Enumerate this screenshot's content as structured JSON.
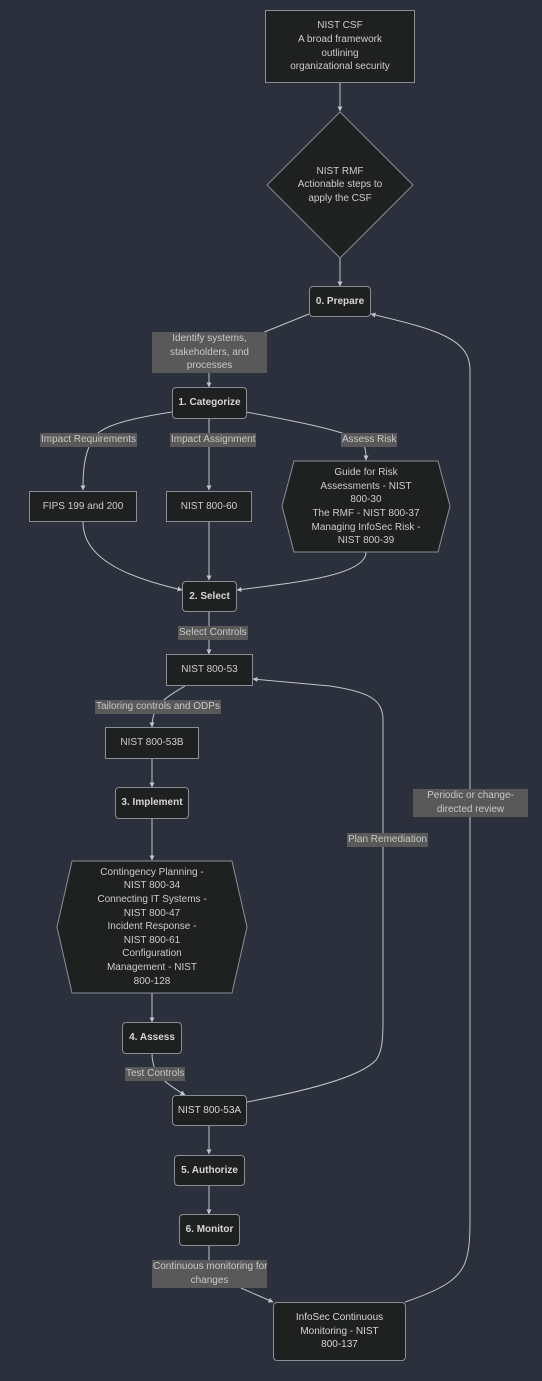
{
  "colors": {
    "background": "#2b303c",
    "node_fill": "#1f2020",
    "node_stroke": "#8a8f96",
    "edge_stroke": "#c0c4cc",
    "edge_label_bg": "#595959",
    "text": "#cccccc"
  },
  "nodes": {
    "csf": {
      "lines": [
        "NIST CSF",
        "A broad framework",
        "outlining",
        "organizational security"
      ]
    },
    "rmf": {
      "lines": [
        "NIST RMF",
        "Actionable steps to",
        "apply the CSF"
      ]
    },
    "prepare": {
      "label": "0. Prepare"
    },
    "identify": {
      "lines": [
        "Identify systems,",
        "stakeholders, and",
        "processes"
      ]
    },
    "categorize": {
      "label": "1. Categorize"
    },
    "fips": {
      "label": "FIPS 199 and 200"
    },
    "nist80060": {
      "label": "NIST 800-60"
    },
    "riskdocs": {
      "lines": [
        "Guide for Risk",
        "Assessments - NIST",
        "800-30",
        "The RMF - NIST 800-37",
        "Managing InfoSec Risk -",
        "NIST 800-39"
      ]
    },
    "select": {
      "label": "2. Select"
    },
    "nist80053": {
      "label": "NIST 800-53"
    },
    "nist80053b": {
      "label": "NIST 800-53B"
    },
    "implement": {
      "label": "3. Implement"
    },
    "impldocs": {
      "lines": [
        "Contingency Planning -",
        "NIST 800-34",
        "Connecting IT Systems -",
        "NIST 800-47",
        "Incident Response -",
        "NIST 800-61",
        "Configuration",
        "Management - NIST",
        "800-128"
      ]
    },
    "assess": {
      "label": "4. Assess"
    },
    "nist80053a": {
      "label": "NIST 800-53A"
    },
    "authorize": {
      "label": "5. Authorize"
    },
    "monitor": {
      "label": "6. Monitor"
    },
    "continuous": {
      "lines": [
        "InfoSec Continuous",
        "Monitoring - NIST",
        "800-137"
      ]
    }
  },
  "edge_labels": {
    "impact_requirements": "Impact Requirements",
    "impact_assignment": "Impact Assignment",
    "assess_risk": "Assess Risk",
    "select_controls": "Select Controls",
    "tailoring": "Tailoring controls and ODPs",
    "plan_remediation": "Plan Remediation",
    "periodic_review": [
      "Periodic or change-",
      "directed review"
    ],
    "test_controls": "Test Controls",
    "continuous_monitoring": [
      "Continuous monitoring for",
      "changes"
    ]
  }
}
